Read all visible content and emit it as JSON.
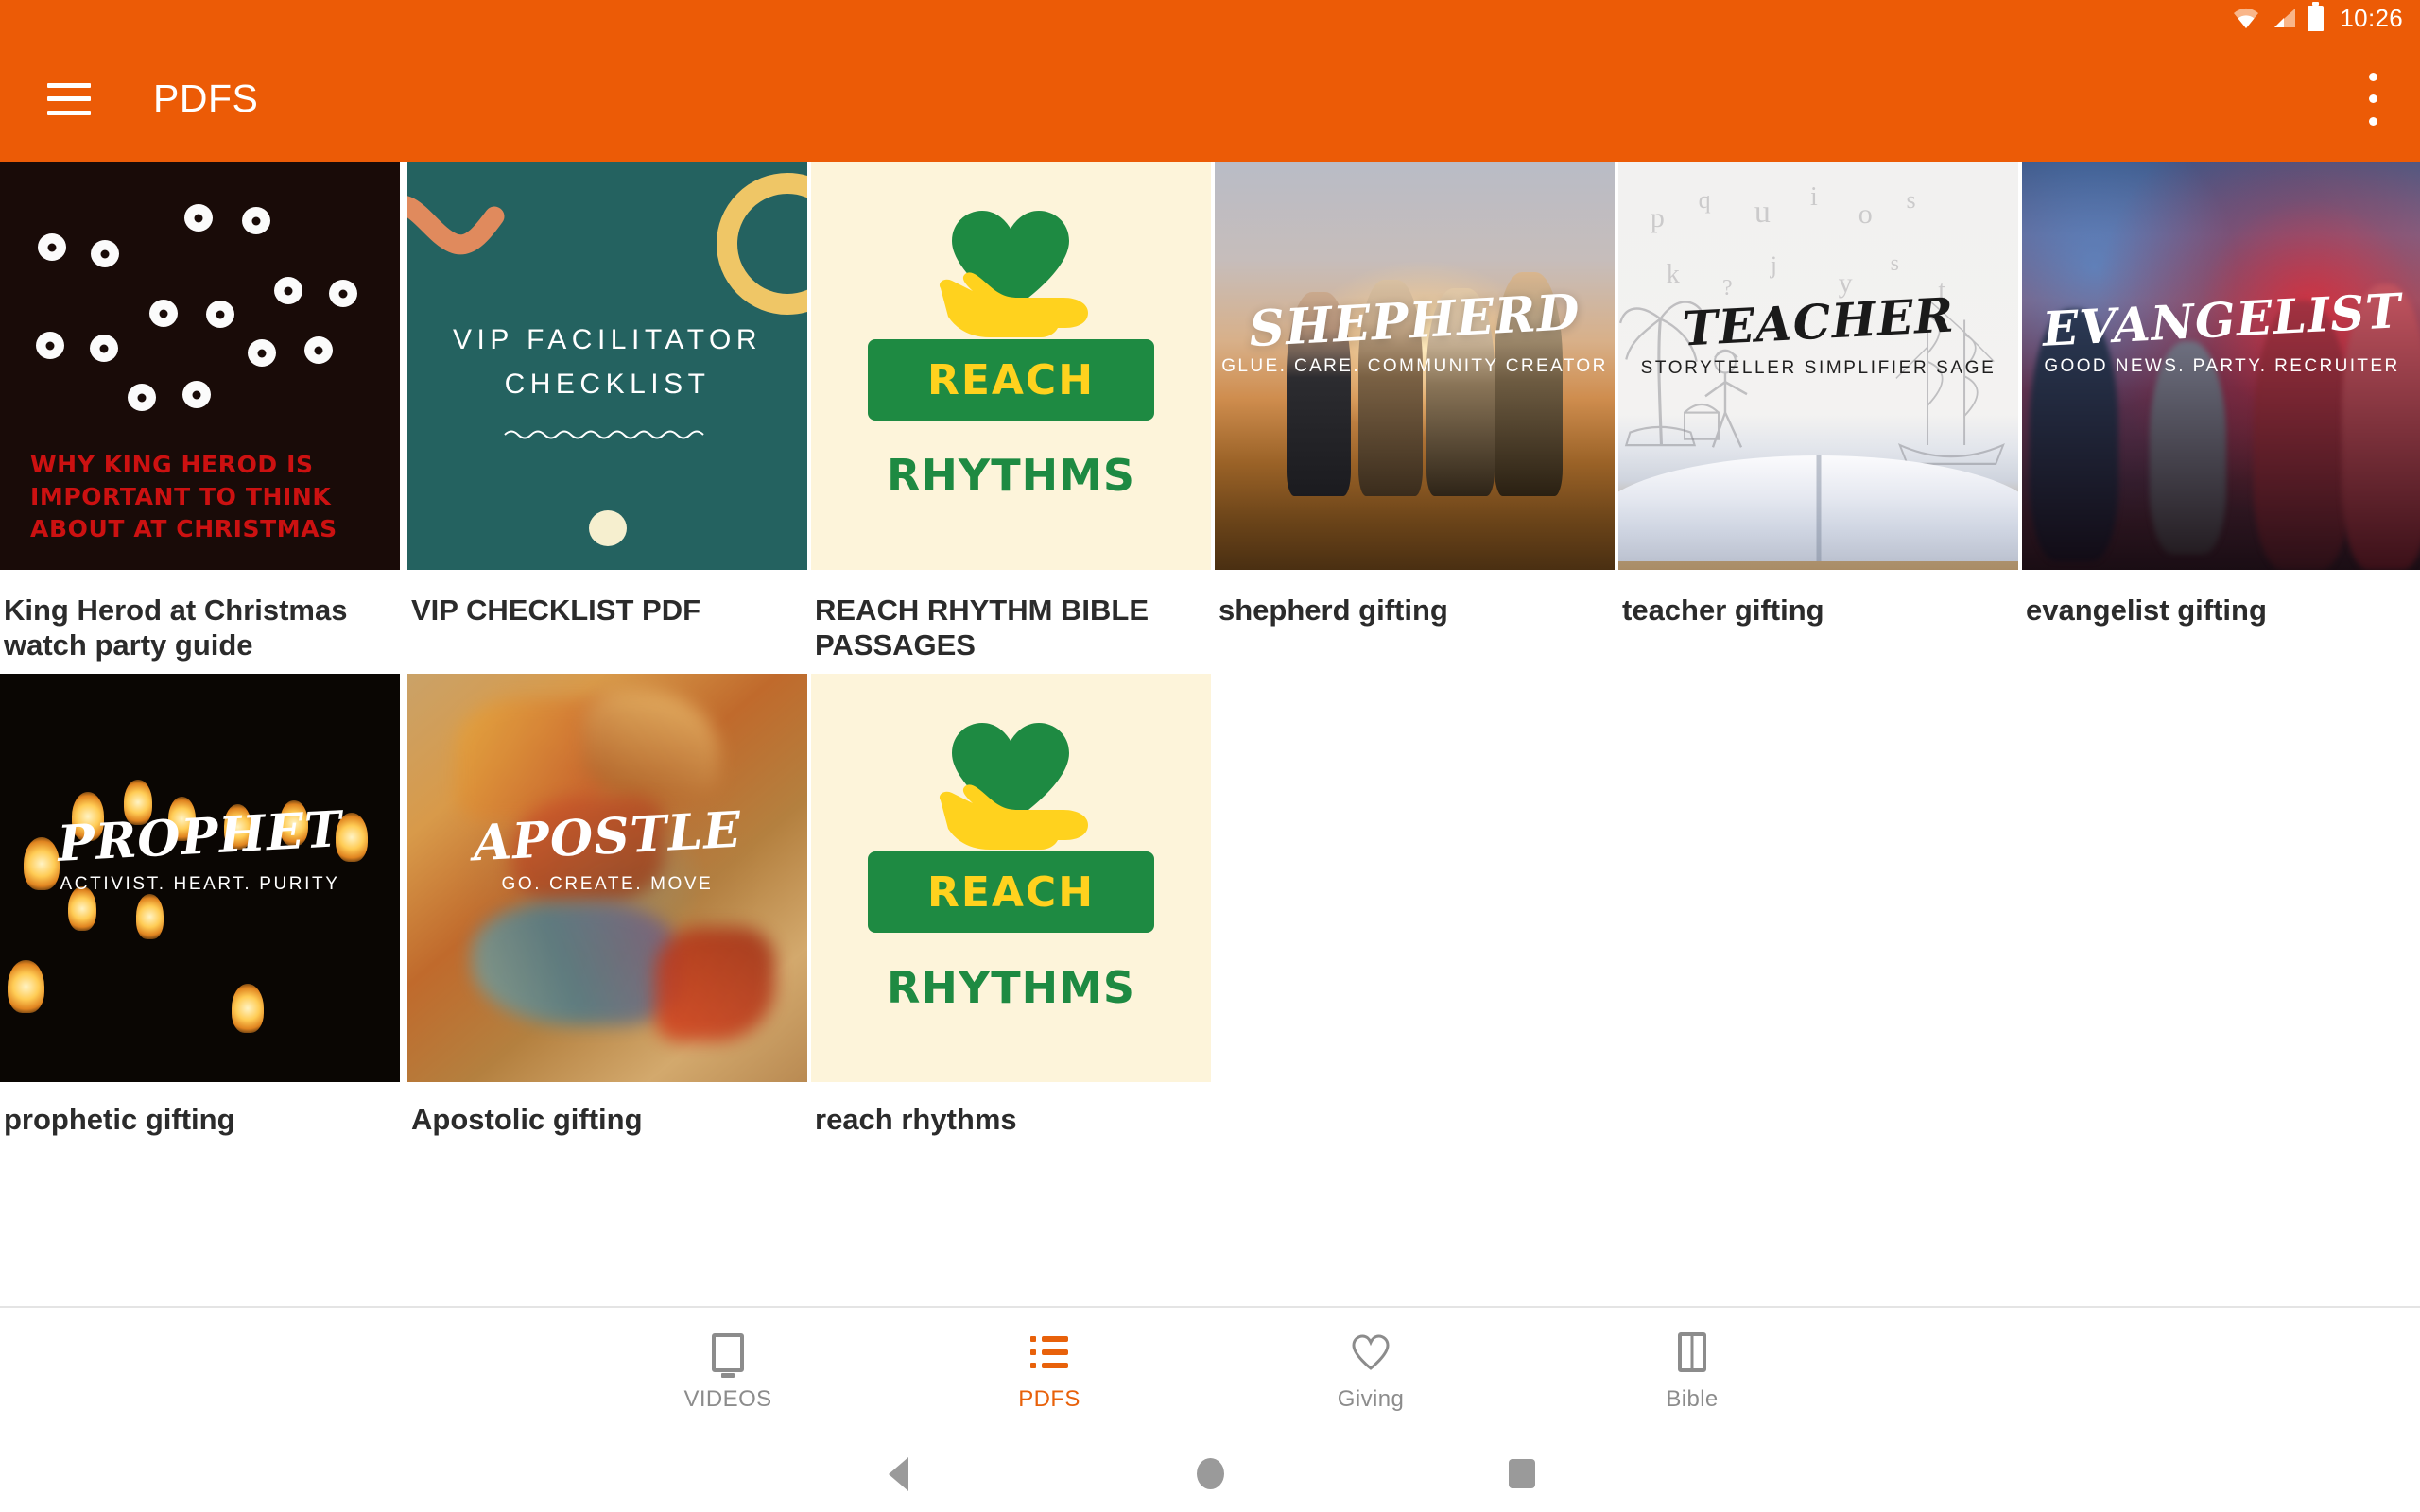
{
  "status_bar": {
    "time": "10:26",
    "icons": [
      "wifi-icon",
      "cellular-signal-icon",
      "battery-icon"
    ]
  },
  "app_bar": {
    "title": "PDFS",
    "menu_icon": "hamburger-menu-icon",
    "overflow_icon": "overflow-menu-icon",
    "background_color": "#EC5B06"
  },
  "grid": {
    "rows": [
      {
        "items": [
          {
            "caption": "King Herod at Christmas watch party guide",
            "thumb": {
              "style": "herod",
              "headline": "WHY KING HEROD IS IMPORTANT TO THINK ABOUT AT CHRISTMAS",
              "bg_color": "#190B08",
              "text_color": "#CC1111"
            }
          },
          {
            "caption": "VIP CHECKLIST PDF",
            "thumb": {
              "style": "vip",
              "line1": "VIP FACILITATOR",
              "line2": "CHECKLIST",
              "bg_color": "#246260",
              "accent_color": "#EFC666",
              "squiggle_color": "#E08A5D"
            }
          },
          {
            "caption": "REACH RHYTHM BIBLE PASSAGES",
            "thumb": {
              "style": "reach",
              "badge_text": "REACH",
              "sub_text": "RHYTHMS",
              "bg_color": "#FDF4DA",
              "green": "#1E8A42",
              "yellow": "#FFD21E"
            }
          },
          {
            "caption": "shepherd gifting",
            "thumb": {
              "style": "shepherd",
              "title": "SHEPHERD",
              "subtitle": "GLUE. CARE. COMMUNITY CREATOR"
            }
          },
          {
            "caption": "teacher gifting",
            "thumb": {
              "style": "teacher",
              "title": "TEACHER",
              "subtitle": "STORYTELLER SIMPLIFIER SAGE"
            }
          },
          {
            "caption": "evangelist gifting",
            "thumb": {
              "style": "evangelist",
              "title": "EVANGELIST",
              "subtitle": "GOOD NEWS. PARTY. RECRUITER"
            }
          }
        ]
      },
      {
        "items": [
          {
            "caption": "prophetic gifting",
            "thumb": {
              "style": "prophet",
              "title": "PROPHET",
              "subtitle": "ACTIVIST. HEART. PURITY"
            }
          },
          {
            "caption": "Apostolic gifting",
            "thumb": {
              "style": "apostle",
              "title": "APOSTLE",
              "subtitle": "GO. CREATE. MOVE"
            }
          },
          {
            "caption": "reach rhythms",
            "thumb": {
              "style": "reach",
              "badge_text": "REACH",
              "sub_text": "RHYTHMS",
              "bg_color": "#FDF4DA",
              "green": "#1E8A42",
              "yellow": "#FFD21E"
            }
          }
        ]
      }
    ]
  },
  "tab_bar": {
    "active_color": "#E8610A",
    "inactive_color": "#8C8C8C",
    "tabs": [
      {
        "label": "VIDEOS",
        "icon": "monitor-icon",
        "active": false
      },
      {
        "label": "PDFS",
        "icon": "list-icon",
        "active": true
      },
      {
        "label": "Giving",
        "icon": "heart-icon",
        "active": false
      },
      {
        "label": "Bible",
        "icon": "book-icon",
        "active": false
      }
    ]
  },
  "android_nav": {
    "back": "back-triangle-icon",
    "home": "home-circle-icon",
    "recents": "recents-square-icon"
  }
}
